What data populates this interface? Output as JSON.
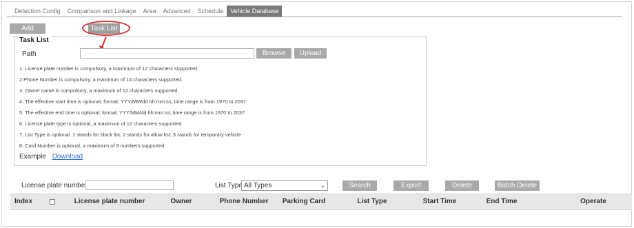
{
  "tabs": [
    {
      "label": "Detection Config"
    },
    {
      "label": "Comparison and Linkage"
    },
    {
      "label": "Area"
    },
    {
      "label": "Advanced"
    },
    {
      "label": "Schedule"
    },
    {
      "label": "Vehicle Database",
      "active": true
    }
  ],
  "toolbar": {
    "add_label": "Add",
    "task_list_label": "Task List"
  },
  "task_list": {
    "legend": "Task List",
    "path_label": "Path",
    "path_value": "",
    "browse_label": "Browse",
    "upload_label": "Upload",
    "notes": [
      "1. License plate number is compulsory, a maximum of 12 characters supported.",
      "2.Phone Number is compulsory, a maximum of 14 characters supported.",
      "3. Owner name is compulsory, a maximum of 12 characters supported.",
      "4. The effective start time is optional; format: YYY/MM/dd hh:mm:ss; time range is from 1970 to 2037.",
      "5. The effective end time is optional; format: YYY/MM/dd hh:mm:ss; time range is from 1970 to 2037.",
      "6. License plate type is optional, a maximum of 12 characters supported.",
      "7. List Type is optional. 1 stands for block list; 2 stands for allow list; 3 stands for temporary vehicle",
      "8. Card Number is optional, a maximum of 9 numbers supported."
    ],
    "example_label": "Example",
    "download_label": "Download"
  },
  "search": {
    "plate_label": "License plate number",
    "plate_value": "",
    "list_type_label": "List Type",
    "list_type_selected": "All Types",
    "search_label": "Search",
    "export_label": "Export",
    "delete_label": "Delete",
    "batch_delete_label": "Batch Delete"
  },
  "table": {
    "columns": [
      "Index",
      "",
      "License plate number",
      "Owner",
      "Phone Number",
      "Parking Card",
      "List Type",
      "Start Time",
      "End Time",
      "Operate"
    ]
  },
  "colors": {
    "accent_annotation": "#d8322f",
    "button_gray": "#a9a9a9",
    "link_blue": "#2e6fc8"
  }
}
